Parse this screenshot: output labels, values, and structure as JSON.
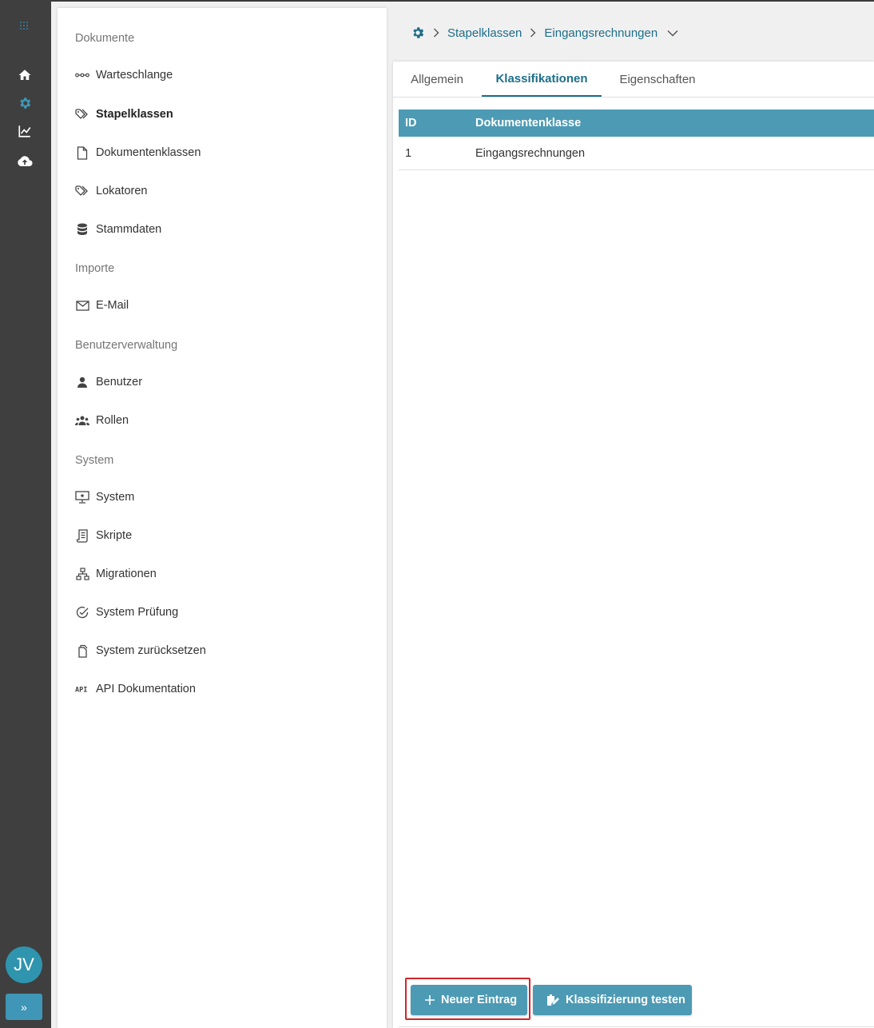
{
  "rail": {
    "avatar_initials": "JV",
    "expand_label": "»",
    "icons": [
      "logo-icon",
      "home-icon",
      "gear-icon",
      "chart-icon",
      "cloud-upload-icon"
    ],
    "active_color": "#3f96b6"
  },
  "menu": {
    "sections": {
      "dokumente": "Dokumente",
      "importe": "Importe",
      "benutzerverwaltung": "Benutzerverwaltung",
      "system": "System"
    },
    "items": {
      "warteschlange": "Warteschlange",
      "stapelklassen": "Stapelklassen",
      "dokumentenklassen": "Dokumentenklassen",
      "lokatoren": "Lokatoren",
      "stammdaten": "Stammdaten",
      "email": "E-Mail",
      "benutzer": "Benutzer",
      "rollen": "Rollen",
      "system": "System",
      "skripte": "Skripte",
      "migrationen": "Migrationen",
      "system_pruefung": "System Prüfung",
      "system_zuruecksetzen": "System zurücksetzen",
      "api_dokumentation": "API Dokumentation"
    },
    "active_item": "Stapelklassen"
  },
  "breadcrumb": {
    "items": [
      "Stapelklassen",
      "Eingangsrechnungen"
    ]
  },
  "tabs": [
    "Allgemein",
    "Klassifikationen",
    "Eigenschaften"
  ],
  "active_tab": "Klassifikationen",
  "table": {
    "headers": [
      "ID",
      "Dokumentenklasse"
    ],
    "rows": [
      [
        "1",
        "Eingangsrechnungen"
      ]
    ]
  },
  "buttons": {
    "new_entry": "Neuer Eintrag",
    "test_classification": "Klassifizierung testen"
  },
  "colors": {
    "primary": "#4d9ab4",
    "link": "#1d6e8a",
    "rail_bg": "#3f3f3f",
    "highlight": "#d0262b"
  }
}
